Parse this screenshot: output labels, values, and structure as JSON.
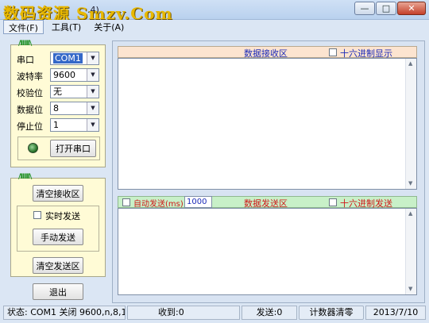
{
  "window": {
    "watermark": "数码资源 Smzy.Com",
    "title_fragment": ".4)",
    "controls": {
      "minimize": "—",
      "maximize": "□",
      "close": "✕"
    }
  },
  "menu": {
    "items": [
      "文件(F)",
      "工具(T)",
      "关于(A)"
    ]
  },
  "serial_panel": {
    "tag": "/IIIII\\",
    "fields": [
      {
        "label": "串口",
        "value": "COM1"
      },
      {
        "label": "波特率",
        "value": "9600"
      },
      {
        "label": "校验位",
        "value": "无"
      },
      {
        "label": "数据位",
        "value": "8"
      },
      {
        "label": "停止位",
        "value": "1"
      }
    ],
    "open_button": "打开串口"
  },
  "control_panel": {
    "tag": "/IIIII\\",
    "clear_receive": "清空接收区",
    "realtime_send": "实时发送",
    "manual_send": "手动发送",
    "clear_send": "清空发送区"
  },
  "exit_button": "退出",
  "receive_area": {
    "title": "数据接收区",
    "hex_display": "十六进制显示"
  },
  "send_area": {
    "auto_send": "自动发送(ms)",
    "interval": "1000",
    "title": "数据发送区",
    "hex_send": "十六进制发送"
  },
  "status_bar": {
    "status": "状态: COM1 关闭 9600,n,8,1",
    "received": "收到:0",
    "sent": "发送:0",
    "reset_counter": "计数器清零",
    "date": "2013/7/10"
  },
  "colors": {
    "panel_bg": "#fffbd6",
    "receive_header": "#fce4d0",
    "send_header": "#c8f0c8",
    "header_blue_text": "#1b2ab8",
    "header_red_text": "#d01818"
  }
}
